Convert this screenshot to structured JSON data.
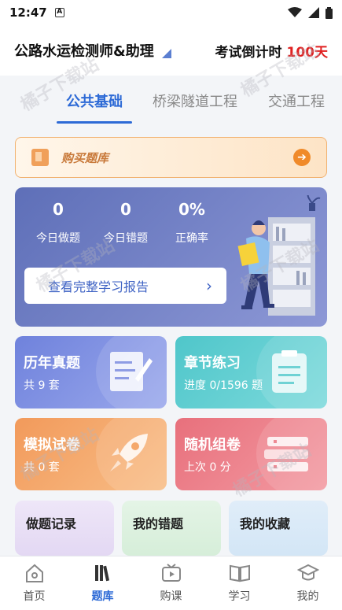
{
  "status_bar": {
    "time": "12:47",
    "indicator": "A"
  },
  "header": {
    "exam_name": "公路水运检测师&助理",
    "countdown_label": "考试倒计时",
    "countdown_days": "100天"
  },
  "tabs": [
    {
      "label": "公共基础",
      "active": true
    },
    {
      "label": "桥梁隧道工程",
      "active": false
    },
    {
      "label": "交通工程",
      "active": false
    }
  ],
  "buy_banner": {
    "label": "购买题库"
  },
  "stats": {
    "items": [
      {
        "value": "0",
        "label": "今日做题"
      },
      {
        "value": "0",
        "label": "今日错题"
      },
      {
        "value": "0%",
        "label": "正确率"
      }
    ],
    "report_button": "查看完整学习报告"
  },
  "modules": [
    {
      "title": "历年真题",
      "sub": "共 9 套",
      "icon": "notebook-pen-icon",
      "color": "#7b8ee2"
    },
    {
      "title": "章节练习",
      "sub": "进度 0/1596 题",
      "icon": "clipboard-icon",
      "color": "#52ccd0"
    },
    {
      "title": "模拟试卷",
      "sub": "共 0 套",
      "icon": "rocket-icon",
      "color": "#f4a264"
    },
    {
      "title": "随机组卷",
      "sub": "上次 0 分",
      "icon": "books-icon",
      "color": "#ec7b86"
    }
  ],
  "records": [
    {
      "title": "做题记录"
    },
    {
      "title": "我的错题"
    },
    {
      "title": "我的收藏"
    }
  ],
  "bottom_nav": [
    {
      "label": "首页",
      "icon": "home-icon",
      "active": false
    },
    {
      "label": "题库",
      "icon": "library-icon",
      "active": true
    },
    {
      "label": "购课",
      "icon": "video-icon",
      "active": false
    },
    {
      "label": "学习",
      "icon": "book-open-icon",
      "active": false
    },
    {
      "label": "我的",
      "icon": "graduation-cap-icon",
      "active": false
    }
  ],
  "watermark": "橘子下载站"
}
